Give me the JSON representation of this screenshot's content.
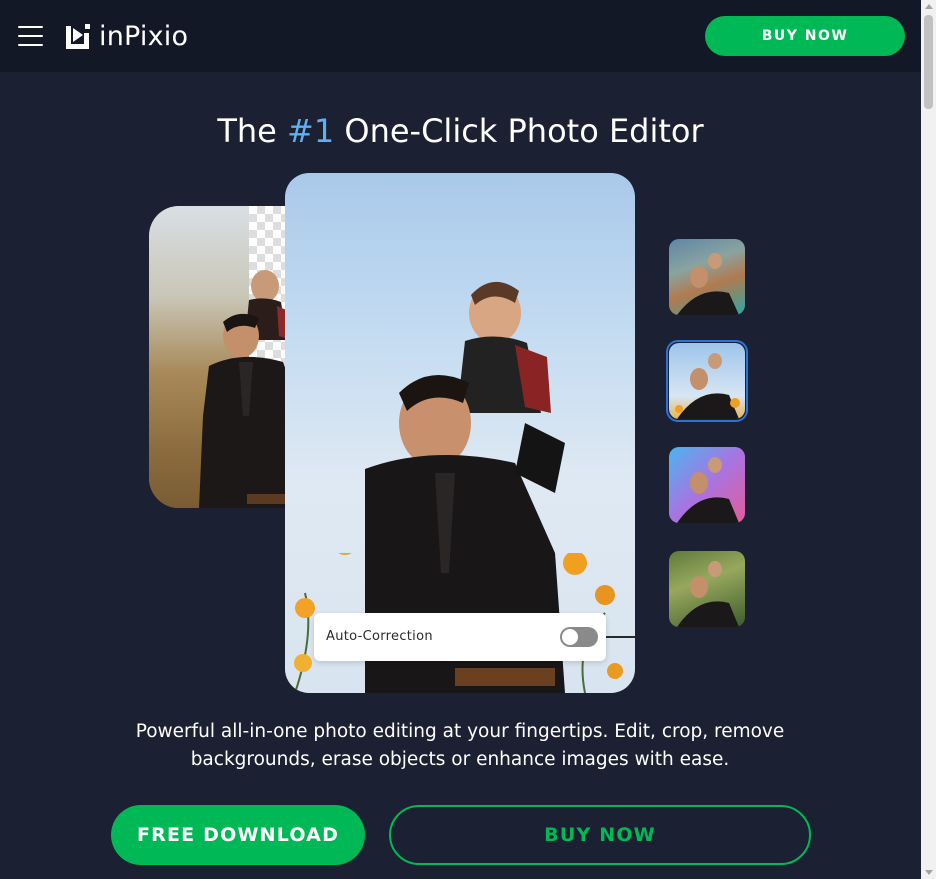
{
  "header": {
    "brand": "inPixio",
    "menu_icon": "hamburger-menu-icon",
    "logo_icon": "play-logo-icon",
    "buy_label": "BUY NOW"
  },
  "hero": {
    "title_prefix": "The ",
    "title_accent": "#1",
    "title_suffix": " One-Click Photo Editor",
    "toggle_label": "Auto-Correction",
    "toggle_state": "off",
    "description": "Powerful all-in-one photo editing at your fingertips. Edit, crop, remove backgrounds, erase objects or enhance images with ease.",
    "free_download_label": "FREE DOWNLOAD",
    "buy_label": "BUY NOW",
    "selected_thumbnail": 2
  },
  "colors": {
    "background": "#1b2033",
    "header": "#131826",
    "accent_green": "#00b956",
    "accent_blue": "#5fb0f3",
    "selection_ring": "#2b74d6"
  }
}
